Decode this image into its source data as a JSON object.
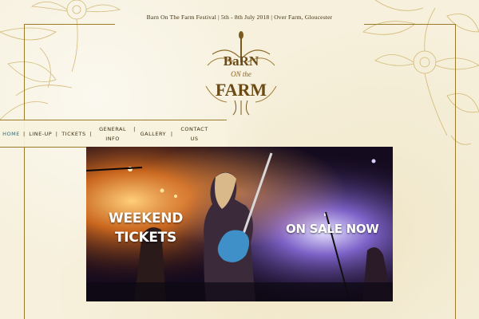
{
  "header": {
    "tagline": "Barn On The Farm Festival | 5th - 8th July 2018 | Over Farm, Gloucester"
  },
  "logo": {
    "line1": "BaRN",
    "line2": "ON the",
    "line3": "FARM",
    "icon": "festival-logo-with-guitar"
  },
  "nav": {
    "items": [
      {
        "label": "HOME",
        "active": true
      },
      {
        "label": "LINE-UP",
        "active": false
      },
      {
        "label": "TICKETS",
        "active": false
      },
      {
        "label1": "GENERAL",
        "label2": "INFO",
        "active": false
      },
      {
        "label": "GALLERY",
        "active": false
      },
      {
        "label1": "CONTACT",
        "label2": "US",
        "active": false
      }
    ],
    "separator": "|",
    "active_color": "#2b6d7a"
  },
  "hero": {
    "line1": "WEEKEND",
    "line2": "TICKETS",
    "on_sale": "ON SALE NOW"
  },
  "colors": {
    "background": "#f6f0dc",
    "frame": "#9b7a2a",
    "text": "#3c2e10"
  }
}
